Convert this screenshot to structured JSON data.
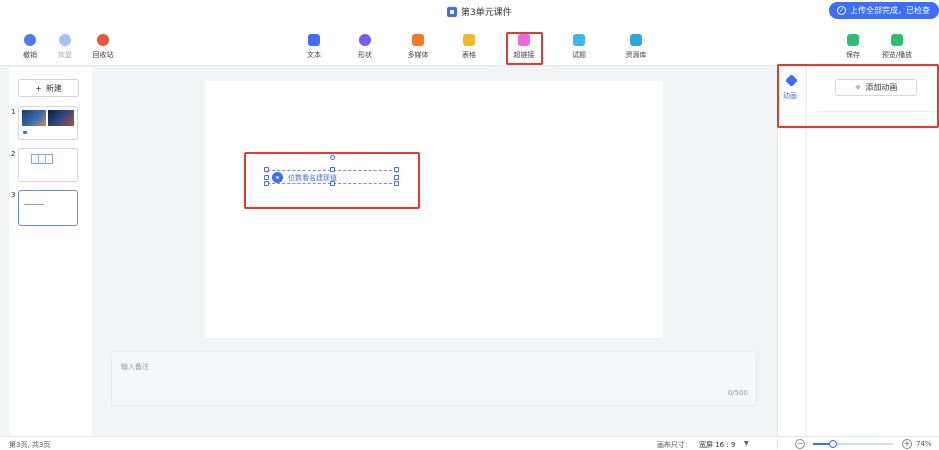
{
  "window": {
    "title": "第3单元课件"
  },
  "upload_status": "上传全部完成，已检查",
  "toolbar": {
    "undo": "撤销",
    "redo": "恢复",
    "recycle": "回收站",
    "text": "文本",
    "shape": "形状",
    "media": "多媒体",
    "table": "表格",
    "hyperlink": "超链接",
    "quiz": "试题",
    "library": "资源库",
    "save": "保存",
    "preview": "预览/播放"
  },
  "colors": {
    "accent": "#3d6ef5",
    "highlight": "#e23b30"
  },
  "sidebar": {
    "new_button": "新建",
    "slides": [
      {
        "num": "1"
      },
      {
        "num": "2"
      },
      {
        "num": "3"
      }
    ]
  },
  "canvas": {
    "link_text": "位数看名建现值"
  },
  "notes": {
    "placeholder": "输入备注",
    "counter": "0/500"
  },
  "right_panel": {
    "tab_label": "动画",
    "add_button": "添加动画"
  },
  "status": {
    "pages": "第3页, 共3页",
    "canvas_size_label": "画布尺寸:",
    "canvas_size_value": "宽屏 16 : 9",
    "zoom": "74%",
    "zoom_fraction": 0.74
  }
}
